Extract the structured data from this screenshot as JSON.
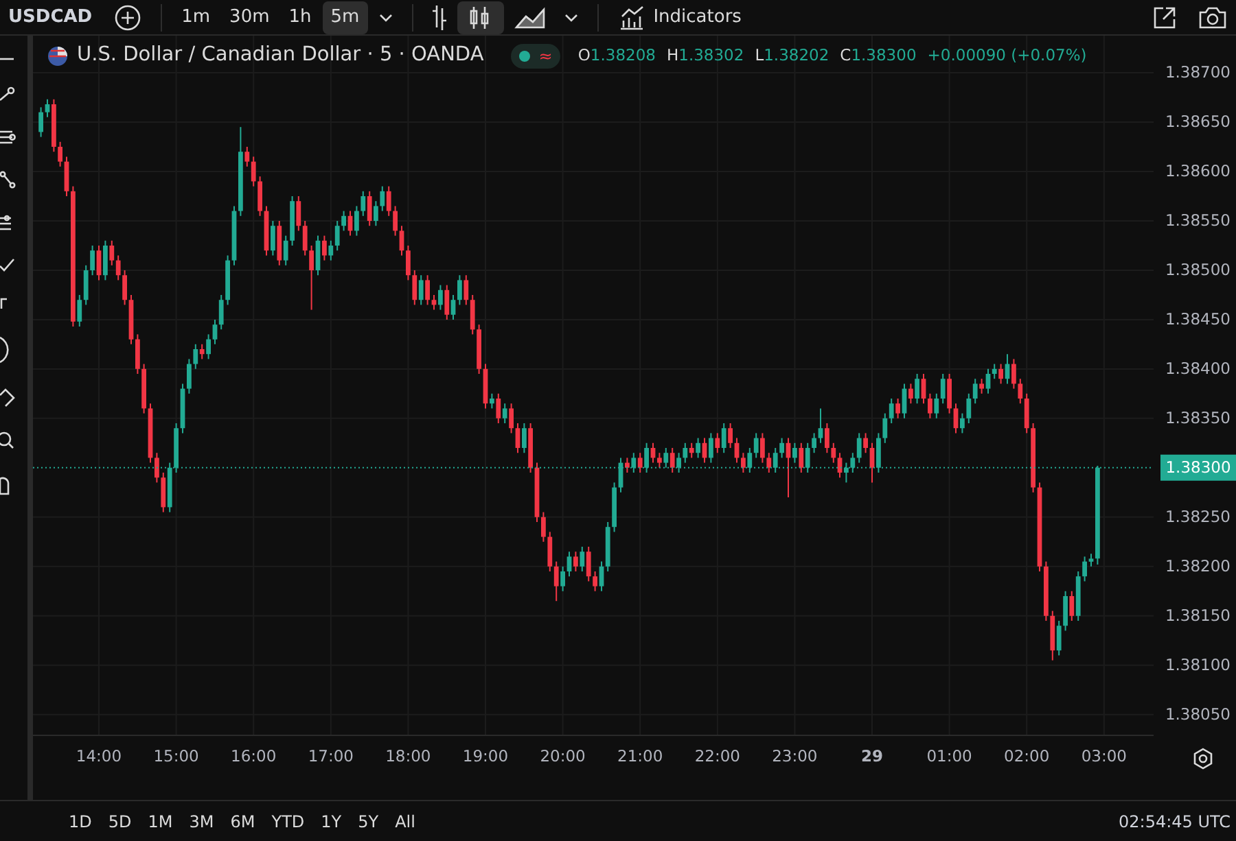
{
  "toolbar": {
    "symbol": "USDCAD",
    "intervals": [
      {
        "label": "1m",
        "selected": false
      },
      {
        "label": "30m",
        "selected": false
      },
      {
        "label": "1h",
        "selected": false
      },
      {
        "label": "5m",
        "selected": true
      }
    ],
    "chart_types": [
      {
        "kind": "bars",
        "selected": false
      },
      {
        "kind": "candles",
        "selected": true
      },
      {
        "kind": "area",
        "selected": false
      }
    ],
    "indicators_label": "Indicators"
  },
  "legend": {
    "title": "U.S. Dollar / Canadian Dollar · 5 · OANDA",
    "status_symbol": "≈",
    "values": [
      {
        "label": "O",
        "value": "1.38208"
      },
      {
        "label": "H",
        "value": "1.38302"
      },
      {
        "label": "L",
        "value": "1.38202"
      },
      {
        "label": "C",
        "value": "1.38300"
      }
    ],
    "change": "+0.00090 (+0.07%)"
  },
  "chart": {
    "time_ticks": [
      {
        "label": "14:00",
        "bold": false
      },
      {
        "label": "15:00",
        "bold": false
      },
      {
        "label": "16:00",
        "bold": false
      },
      {
        "label": "17:00",
        "bold": false
      },
      {
        "label": "18:00",
        "bold": false
      },
      {
        "label": "19:00",
        "bold": false
      },
      {
        "label": "20:00",
        "bold": false
      },
      {
        "label": "21:00",
        "bold": false
      },
      {
        "label": "22:00",
        "bold": false
      },
      {
        "label": "23:00",
        "bold": false
      },
      {
        "label": "29",
        "bold": true
      },
      {
        "label": "01:00",
        "bold": false
      },
      {
        "label": "02:00",
        "bold": false
      },
      {
        "label": "03:00",
        "bold": false
      }
    ],
    "chart_data": {
      "type": "candlestick",
      "grid": true,
      "ylim": [
        1.38029,
        1.387375
      ],
      "categories": [
        null,
        null,
        null,
        null,
        null,
        null,
        null,
        null,
        null,
        null,
        null,
        null,
        null,
        null,
        null,
        null,
        null,
        null,
        null,
        null,
        null,
        null,
        null,
        null,
        null,
        null,
        null,
        null,
        null,
        null,
        null,
        null,
        null,
        null,
        null,
        null,
        null,
        null,
        null,
        null,
        null,
        null,
        null,
        null,
        null,
        null,
        null,
        null,
        null,
        null,
        null,
        null,
        null,
        null,
        null,
        null,
        null,
        null,
        null,
        null,
        null,
        null,
        null,
        null,
        null,
        null,
        null,
        null,
        null,
        null,
        null,
        null,
        null,
        null,
        null,
        null,
        null,
        null,
        null,
        null,
        null,
        null,
        null,
        null,
        null,
        null,
        null,
        null,
        null,
        null,
        null,
        null,
        null,
        null,
        null,
        null,
        null,
        null,
        null,
        null,
        null,
        null,
        null,
        null,
        null,
        null,
        null,
        null,
        null,
        null,
        null,
        null,
        null,
        null,
        null,
        null,
        null,
        null,
        null,
        null,
        null,
        null,
        null,
        null,
        null,
        null,
        null,
        null,
        null,
        null,
        null,
        null,
        null,
        null,
        null,
        null,
        null,
        null,
        null,
        null,
        null,
        null,
        null,
        null,
        null,
        null,
        null,
        null,
        null,
        null,
        null,
        null,
        null,
        null,
        null,
        null,
        null,
        null,
        null,
        null,
        null,
        null,
        null,
        null,
        null
      ],
      "yticks": [
        {
          "value": 1.387,
          "label": "1.38700"
        },
        {
          "value": 1.3865,
          "label": "1.38650"
        },
        {
          "value": 1.386,
          "label": "1.38600"
        },
        {
          "value": 1.3855,
          "label": "1.38550"
        },
        {
          "value": 1.385,
          "label": "1.38500"
        },
        {
          "value": 1.3845,
          "label": "1.38450"
        },
        {
          "value": 1.384,
          "label": "1.38400"
        },
        {
          "value": 1.3835,
          "label": "1.38350"
        },
        {
          "value": 1.3825,
          "label": "1.38250"
        },
        {
          "value": 1.382,
          "label": "1.38200"
        },
        {
          "value": 1.3815,
          "label": "1.38150"
        },
        {
          "value": 1.381,
          "label": "1.38100"
        },
        {
          "value": 1.3805,
          "label": "1.38050"
        }
      ],
      "ref_lines": [
        {
          "axis": "y",
          "value": 1.383,
          "label": "1.38300",
          "color": "#22ab94"
        }
      ],
      "ohlc": [
        [
          1.3864,
          1.38665,
          1.38635,
          1.3866
        ],
        [
          1.3866,
          1.38673,
          1.38655,
          1.38668
        ],
        [
          1.38668,
          1.38673,
          1.3862,
          1.38625
        ],
        [
          1.38625,
          1.3863,
          1.38605,
          1.3861
        ],
        [
          1.3861,
          1.38615,
          1.38575,
          1.3858
        ],
        [
          1.3858,
          1.38585,
          1.38443,
          1.38448
        ],
        [
          1.38448,
          1.38475,
          1.38443,
          1.3847
        ],
        [
          1.3847,
          1.38505,
          1.38465,
          1.385
        ],
        [
          1.385,
          1.38525,
          1.38495,
          1.3852
        ],
        [
          1.3852,
          1.38525,
          1.3849,
          1.38495
        ],
        [
          1.38495,
          1.3853,
          1.3849,
          1.38525
        ],
        [
          1.38525,
          1.3853,
          1.38505,
          1.3851
        ],
        [
          1.3851,
          1.38515,
          1.3849,
          1.38495
        ],
        [
          1.38495,
          1.385,
          1.38465,
          1.3847
        ],
        [
          1.3847,
          1.38475,
          1.38425,
          1.3843
        ],
        [
          1.3843,
          1.38435,
          1.38395,
          1.384
        ],
        [
          1.384,
          1.38405,
          1.38355,
          1.3836
        ],
        [
          1.3836,
          1.38365,
          1.38305,
          1.3831
        ],
        [
          1.3831,
          1.38315,
          1.38285,
          1.3829
        ],
        [
          1.3829,
          1.38295,
          1.38255,
          1.3826
        ],
        [
          1.3826,
          1.38305,
          1.38255,
          1.383
        ],
        [
          1.383,
          1.38345,
          1.38295,
          1.3834
        ],
        [
          1.3834,
          1.38385,
          1.38335,
          1.3838
        ],
        [
          1.3838,
          1.3841,
          1.38375,
          1.38405
        ],
        [
          1.38405,
          1.38425,
          1.384,
          1.3842
        ],
        [
          1.3842,
          1.38425,
          1.3841,
          1.38415
        ],
        [
          1.38415,
          1.38435,
          1.3841,
          1.3843
        ],
        [
          1.3843,
          1.3845,
          1.38425,
          1.38445
        ],
        [
          1.38445,
          1.38475,
          1.3844,
          1.3847
        ],
        [
          1.3847,
          1.38515,
          1.38465,
          1.3851
        ],
        [
          1.3851,
          1.38565,
          1.38505,
          1.3856
        ],
        [
          1.3856,
          1.38645,
          1.38555,
          1.3862
        ],
        [
          1.3862,
          1.38625,
          1.38605,
          1.3861
        ],
        [
          1.3861,
          1.38615,
          1.38585,
          1.3859
        ],
        [
          1.3859,
          1.38595,
          1.38555,
          1.3856
        ],
        [
          1.3856,
          1.38565,
          1.38515,
          1.3852
        ],
        [
          1.3852,
          1.3855,
          1.38515,
          1.38545
        ],
        [
          1.38545,
          1.3855,
          1.38505,
          1.3851
        ],
        [
          1.3851,
          1.38535,
          1.38505,
          1.3853
        ],
        [
          1.3853,
          1.38575,
          1.38525,
          1.3857
        ],
        [
          1.3857,
          1.38575,
          1.3854,
          1.38545
        ],
        [
          1.38545,
          1.3855,
          1.38515,
          1.3852
        ],
        [
          1.3852,
          1.38525,
          1.3846,
          1.385
        ],
        [
          1.385,
          1.38535,
          1.38495,
          1.3853
        ],
        [
          1.3853,
          1.38535,
          1.3851,
          1.38515
        ],
        [
          1.38515,
          1.3853,
          1.3851,
          1.38525
        ],
        [
          1.38525,
          1.3855,
          1.3852,
          1.38545
        ],
        [
          1.38545,
          1.3856,
          1.3854,
          1.38555
        ],
        [
          1.38555,
          1.3856,
          1.38535,
          1.3854
        ],
        [
          1.3854,
          1.38565,
          1.38535,
          1.3856
        ],
        [
          1.3856,
          1.3858,
          1.38555,
          1.38575
        ],
        [
          1.38575,
          1.3858,
          1.38545,
          1.3855
        ],
        [
          1.3855,
          1.3857,
          1.38545,
          1.38565
        ],
        [
          1.38565,
          1.38585,
          1.3856,
          1.3858
        ],
        [
          1.3858,
          1.38585,
          1.38555,
          1.3856
        ],
        [
          1.3856,
          1.38565,
          1.38535,
          1.3854
        ],
        [
          1.3854,
          1.38545,
          1.38515,
          1.3852
        ],
        [
          1.3852,
          1.38525,
          1.3849,
          1.38495
        ],
        [
          1.38495,
          1.385,
          1.38465,
          1.3847
        ],
        [
          1.3847,
          1.38495,
          1.38465,
          1.3849
        ],
        [
          1.3849,
          1.38495,
          1.38465,
          1.3847
        ],
        [
          1.3847,
          1.38475,
          1.3846,
          1.38465
        ],
        [
          1.38465,
          1.38485,
          1.3846,
          1.3848
        ],
        [
          1.3848,
          1.38485,
          1.3845,
          1.38455
        ],
        [
          1.38455,
          1.38475,
          1.3845,
          1.3847
        ],
        [
          1.3847,
          1.38495,
          1.38465,
          1.3849
        ],
        [
          1.3849,
          1.38495,
          1.38465,
          1.3847
        ],
        [
          1.3847,
          1.38475,
          1.38435,
          1.3844
        ],
        [
          1.3844,
          1.38445,
          1.38395,
          1.384
        ],
        [
          1.384,
          1.38405,
          1.3836,
          1.38365
        ],
        [
          1.38365,
          1.38375,
          1.3836,
          1.3837
        ],
        [
          1.3837,
          1.38375,
          1.38345,
          1.3835
        ],
        [
          1.3835,
          1.38365,
          1.38345,
          1.3836
        ],
        [
          1.3836,
          1.38365,
          1.38335,
          1.3834
        ],
        [
          1.3834,
          1.38345,
          1.38315,
          1.3832
        ],
        [
          1.3832,
          1.38345,
          1.38315,
          1.3834
        ],
        [
          1.3834,
          1.38345,
          1.38295,
          1.383
        ],
        [
          1.383,
          1.38305,
          1.38245,
          1.3825
        ],
        [
          1.3825,
          1.38255,
          1.38225,
          1.3823
        ],
        [
          1.3823,
          1.38235,
          1.38195,
          1.382
        ],
        [
          1.382,
          1.38205,
          1.38165,
          1.3818
        ],
        [
          1.3818,
          1.382,
          1.38175,
          1.38195
        ],
        [
          1.38195,
          1.38215,
          1.3819,
          1.3821
        ],
        [
          1.3821,
          1.38215,
          1.38195,
          1.382
        ],
        [
          1.382,
          1.3822,
          1.38195,
          1.38215
        ],
        [
          1.38215,
          1.3822,
          1.38185,
          1.3819
        ],
        [
          1.3819,
          1.38195,
          1.38175,
          1.3818
        ],
        [
          1.3818,
          1.38205,
          1.38175,
          1.382
        ],
        [
          1.382,
          1.38245,
          1.38195,
          1.3824
        ],
        [
          1.3824,
          1.38285,
          1.38235,
          1.3828
        ],
        [
          1.3828,
          1.3831,
          1.38275,
          1.38305
        ],
        [
          1.38305,
          1.3831,
          1.38295,
          1.383
        ],
        [
          1.383,
          1.38315,
          1.38295,
          1.3831
        ],
        [
          1.3831,
          1.38315,
          1.38295,
          1.383
        ],
        [
          1.383,
          1.38325,
          1.38295,
          1.3832
        ],
        [
          1.3832,
          1.38325,
          1.38305,
          1.3831
        ],
        [
          1.3831,
          1.38315,
          1.383,
          1.38305
        ],
        [
          1.38305,
          1.3832,
          1.383,
          1.38315
        ],
        [
          1.38315,
          1.3832,
          1.38295,
          1.383
        ],
        [
          1.383,
          1.38315,
          1.38295,
          1.3831
        ],
        [
          1.3831,
          1.38325,
          1.38305,
          1.3832
        ],
        [
          1.3832,
          1.38325,
          1.3831,
          1.38315
        ],
        [
          1.38315,
          1.3833,
          1.3831,
          1.38325
        ],
        [
          1.38325,
          1.3833,
          1.38305,
          1.3831
        ],
        [
          1.3831,
          1.38335,
          1.38305,
          1.3833
        ],
        [
          1.3833,
          1.38335,
          1.38315,
          1.3832
        ],
        [
          1.3832,
          1.38345,
          1.38315,
          1.3834
        ],
        [
          1.3834,
          1.38345,
          1.3832,
          1.38325
        ],
        [
          1.38325,
          1.3833,
          1.38305,
          1.3831
        ],
        [
          1.3831,
          1.38315,
          1.38295,
          1.383
        ],
        [
          1.383,
          1.3832,
          1.38295,
          1.38315
        ],
        [
          1.38315,
          1.38335,
          1.3831,
          1.3833
        ],
        [
          1.3833,
          1.38335,
          1.38305,
          1.3831
        ],
        [
          1.3831,
          1.38315,
          1.38295,
          1.383
        ],
        [
          1.383,
          1.3832,
          1.38295,
          1.38315
        ],
        [
          1.38315,
          1.3833,
          1.3831,
          1.38325
        ],
        [
          1.38325,
          1.3833,
          1.3827,
          1.3831
        ],
        [
          1.3831,
          1.38325,
          1.38305,
          1.3832
        ],
        [
          1.3832,
          1.38325,
          1.38295,
          1.383
        ],
        [
          1.383,
          1.38325,
          1.38295,
          1.3832
        ],
        [
          1.3832,
          1.38335,
          1.38315,
          1.3833
        ],
        [
          1.3833,
          1.3836,
          1.38325,
          1.3834
        ],
        [
          1.3834,
          1.38345,
          1.38315,
          1.3832
        ],
        [
          1.3832,
          1.38325,
          1.38305,
          1.3831
        ],
        [
          1.3831,
          1.38315,
          1.3829,
          1.38295
        ],
        [
          1.38295,
          1.38305,
          1.38285,
          1.383
        ],
        [
          1.383,
          1.38315,
          1.38295,
          1.3831
        ],
        [
          1.3831,
          1.38335,
          1.38305,
          1.3833
        ],
        [
          1.3833,
          1.38335,
          1.38315,
          1.3832
        ],
        [
          1.3832,
          1.38325,
          1.38285,
          1.383
        ],
        [
          1.383,
          1.38335,
          1.38295,
          1.3833
        ],
        [
          1.3833,
          1.38355,
          1.38325,
          1.3835
        ],
        [
          1.3835,
          1.3837,
          1.38345,
          1.38365
        ],
        [
          1.38365,
          1.3837,
          1.3835,
          1.38355
        ],
        [
          1.38355,
          1.38385,
          1.3835,
          1.3838
        ],
        [
          1.3838,
          1.38385,
          1.38365,
          1.3837
        ],
        [
          1.3837,
          1.38395,
          1.38365,
          1.3839
        ],
        [
          1.3839,
          1.38395,
          1.38365,
          1.3837
        ],
        [
          1.3837,
          1.38375,
          1.3835,
          1.38355
        ],
        [
          1.38355,
          1.38375,
          1.3835,
          1.3837
        ],
        [
          1.3837,
          1.38395,
          1.38365,
          1.3839
        ],
        [
          1.3839,
          1.38395,
          1.38355,
          1.3836
        ],
        [
          1.3836,
          1.38365,
          1.38335,
          1.3834
        ],
        [
          1.3834,
          1.38355,
          1.38335,
          1.3835
        ],
        [
          1.3835,
          1.38375,
          1.38345,
          1.3837
        ],
        [
          1.3837,
          1.3839,
          1.38365,
          1.38385
        ],
        [
          1.38385,
          1.3839,
          1.38375,
          1.3838
        ],
        [
          1.3838,
          1.384,
          1.38375,
          1.38395
        ],
        [
          1.38395,
          1.38405,
          1.3839,
          1.384
        ],
        [
          1.384,
          1.38405,
          1.38385,
          1.3839
        ],
        [
          1.3839,
          1.38415,
          1.38385,
          1.38405
        ],
        [
          1.38405,
          1.3841,
          1.3838,
          1.38385
        ],
        [
          1.38385,
          1.3839,
          1.38365,
          1.3837
        ],
        [
          1.3837,
          1.38375,
          1.38335,
          1.3834
        ],
        [
          1.3834,
          1.38345,
          1.38275,
          1.3828
        ],
        [
          1.3828,
          1.38285,
          1.38195,
          1.382
        ],
        [
          1.382,
          1.38205,
          1.38145,
          1.3815
        ],
        [
          1.3815,
          1.38155,
          1.38105,
          1.38115
        ],
        [
          1.38115,
          1.38145,
          1.3811,
          1.3814
        ],
        [
          1.3814,
          1.38175,
          1.38135,
          1.3817
        ],
        [
          1.3817,
          1.38175,
          1.38145,
          1.3815
        ],
        [
          1.3815,
          1.38195,
          1.38145,
          1.3819
        ],
        [
          1.3819,
          1.3821,
          1.38185,
          1.38205
        ],
        [
          1.38205,
          1.38213,
          1.382,
          1.38208
        ],
        [
          1.38208,
          1.38302,
          1.38202,
          1.383
        ]
      ]
    }
  },
  "ranges": [
    "1D",
    "5D",
    "1M",
    "3M",
    "6M",
    "YTD",
    "1Y",
    "5Y",
    "All"
  ],
  "clock": "02:54:45 UTC"
}
